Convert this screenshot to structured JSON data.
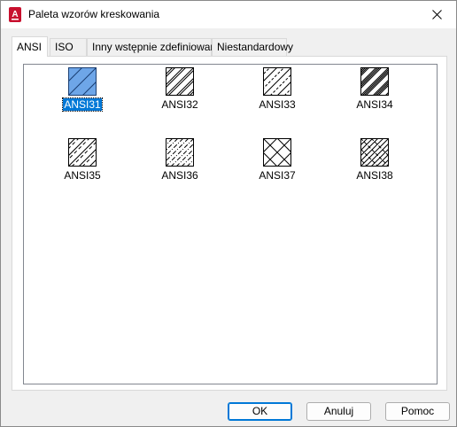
{
  "window": {
    "title": "Paleta wzorów kreskowania",
    "app_icon": "autocad-icon",
    "app_icon_letter": "A",
    "close_icon": "close-icon"
  },
  "tabs": [
    {
      "label": "ANSI",
      "active": true
    },
    {
      "label": "ISO",
      "active": false
    },
    {
      "label": "Inny wstępnie zdefiniowany",
      "active": false
    },
    {
      "label": "Niestandardowy",
      "active": false
    }
  ],
  "patterns": [
    {
      "name": "ANSI31",
      "selected": true
    },
    {
      "name": "ANSI32",
      "selected": false
    },
    {
      "name": "ANSI33",
      "selected": false
    },
    {
      "name": "ANSI34",
      "selected": false
    },
    {
      "name": "ANSI35",
      "selected": false
    },
    {
      "name": "ANSI36",
      "selected": false
    },
    {
      "name": "ANSI37",
      "selected": false
    },
    {
      "name": "ANSI38",
      "selected": false
    }
  ],
  "buttons": {
    "ok": "OK",
    "cancel": "Anuluj",
    "help": "Pomoc"
  },
  "colors": {
    "selection": "#0078d7",
    "selected_swatch": "#6ea6e8"
  }
}
